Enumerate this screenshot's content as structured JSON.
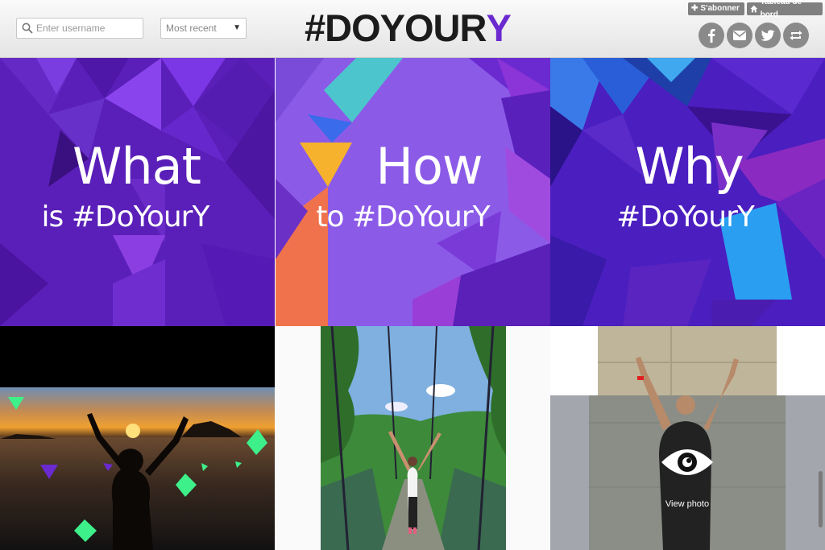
{
  "header": {
    "search_placeholder": "Enter username",
    "sort_selected": "Most recent",
    "logo_main": "#DOYOUR",
    "logo_accent": "Y",
    "subscribe_label": "S'abonner",
    "dashboard_label": "Tableau de bord",
    "social": [
      "facebook-icon",
      "mail-icon",
      "twitter-icon",
      "repost-icon"
    ]
  },
  "tiles": [
    {
      "big": "What",
      "small": "is #DoYourY"
    },
    {
      "big": "How",
      "small": "to #DoYourY"
    },
    {
      "big": "Why",
      "small": "#DoYourY"
    }
  ],
  "photos": {
    "overlay_label": "View photo"
  },
  "colors": {
    "brand_purple": "#6a2ad0",
    "tile_what": "#5a1fb8",
    "tile_how": "#8b5be8",
    "tile_why": "#4b1ec0",
    "mint": "#3df08a"
  }
}
